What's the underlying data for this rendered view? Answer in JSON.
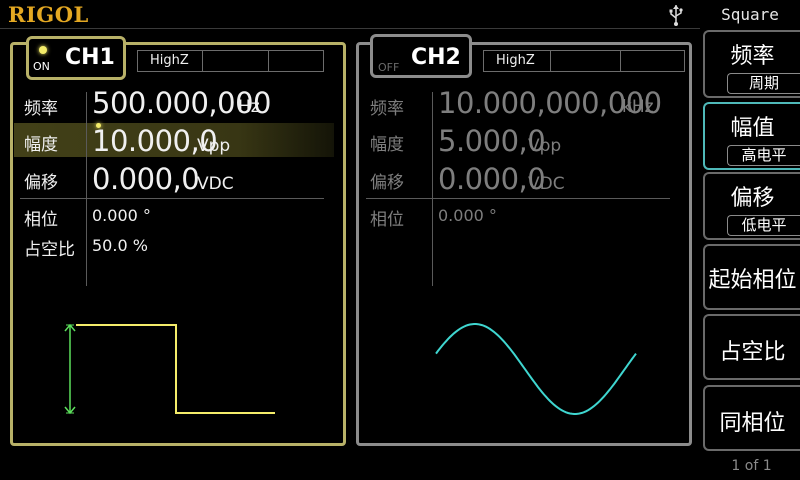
{
  "header": {
    "brand": "RIGOL",
    "usb_icon": "usb-icon",
    "waveform_name": "Square"
  },
  "ch1": {
    "name": "CH1",
    "state": "ON",
    "impedance": "HighZ",
    "freq_label": "频率",
    "freq_value": "500.000,000",
    "freq_unit": "Hz",
    "amp_label": "幅度",
    "amp_value": "10.000,0",
    "amp_unit": "Vpp",
    "offset_label": "偏移",
    "offset_value": "0.000,0",
    "offset_unit": "VDC",
    "phase_label": "相位",
    "phase_value": "0.000 °",
    "duty_label": "占空比",
    "duty_value": "50.0 %",
    "waveform": "square",
    "color": "#f4ec6a"
  },
  "ch2": {
    "name": "CH2",
    "state": "OFF",
    "impedance": "HighZ",
    "freq_label": "频率",
    "freq_value": "10.000,000,000",
    "freq_unit": "kHz",
    "amp_label": "幅度",
    "amp_value": "5.000,0",
    "amp_unit": "Vpp",
    "offset_label": "偏移",
    "offset_value": "0.000,0",
    "offset_unit": "VDC",
    "phase_label": "相位",
    "phase_value": "0.000 °",
    "waveform": "sine",
    "color": "#3fd6d0"
  },
  "softkeys": {
    "freq": "频率",
    "period": "周期",
    "amplitude": "幅值",
    "high_level": "高电平",
    "offset": "偏移",
    "low_level": "低电平",
    "start_phase": "起始相位",
    "duty": "占空比",
    "align_phase": "同相位",
    "page": "1 of 1"
  },
  "colors": {
    "ch1_border": "#b8b168",
    "ch2_border": "#8c8c8c",
    "selected_key": "#4fb9b9",
    "brand": "#e4a822"
  }
}
